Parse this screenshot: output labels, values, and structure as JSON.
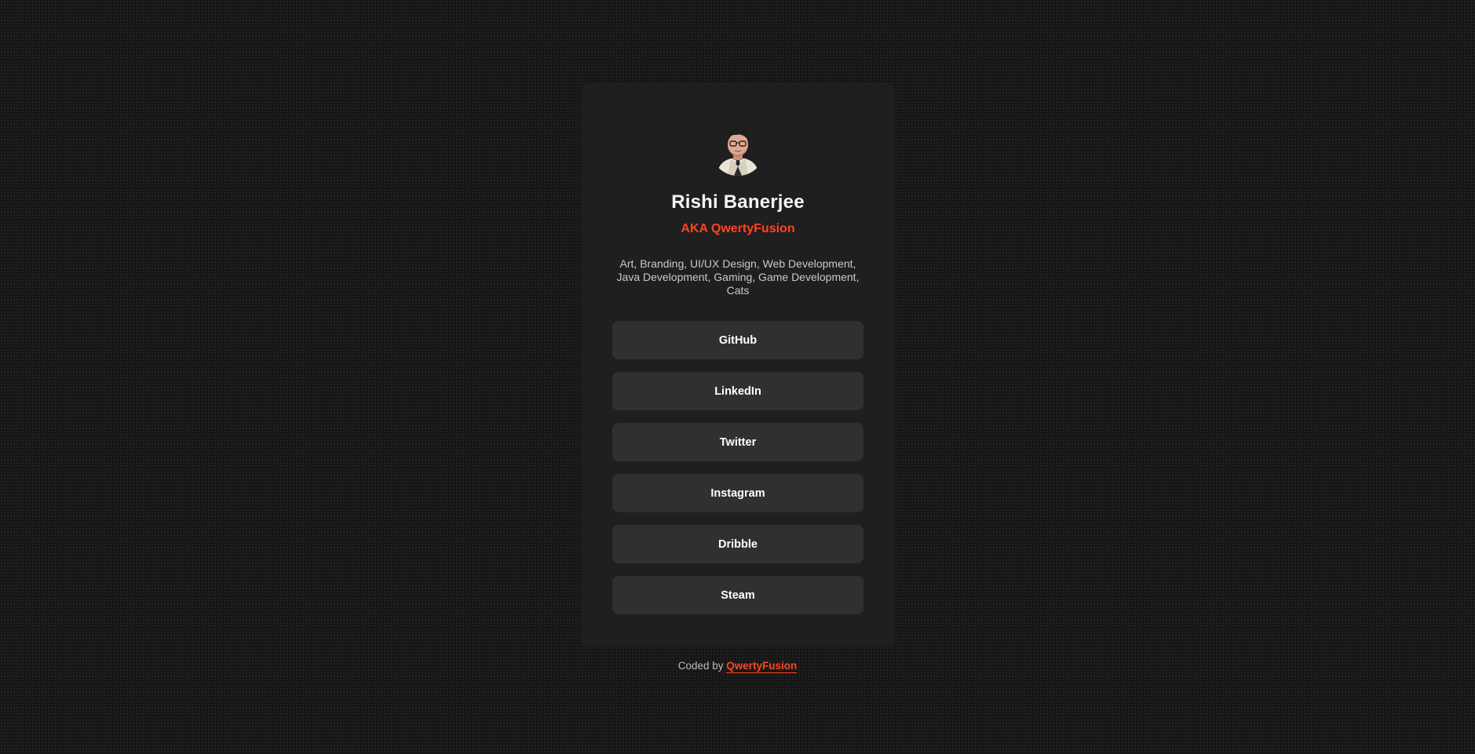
{
  "profile": {
    "name": "Rishi Banerjee",
    "aka": "AKA QwertyFusion",
    "bio": "Art, Branding, UI/UX Design, Web Development, Java Development, Gaming, Game Development, Cats",
    "avatar_icon": "cartoon-avatar-icon"
  },
  "links": [
    {
      "label": "GitHub"
    },
    {
      "label": "LinkedIn"
    },
    {
      "label": "Twitter"
    },
    {
      "label": "Instagram"
    },
    {
      "label": "Dribble"
    },
    {
      "label": "Steam"
    }
  ],
  "footer": {
    "prefix": "Coded by",
    "author": "QwertyFusion"
  },
  "colors": {
    "accent": "#ff4522",
    "background": "#161616",
    "card": "#1f1f1f",
    "button": "#303030"
  }
}
